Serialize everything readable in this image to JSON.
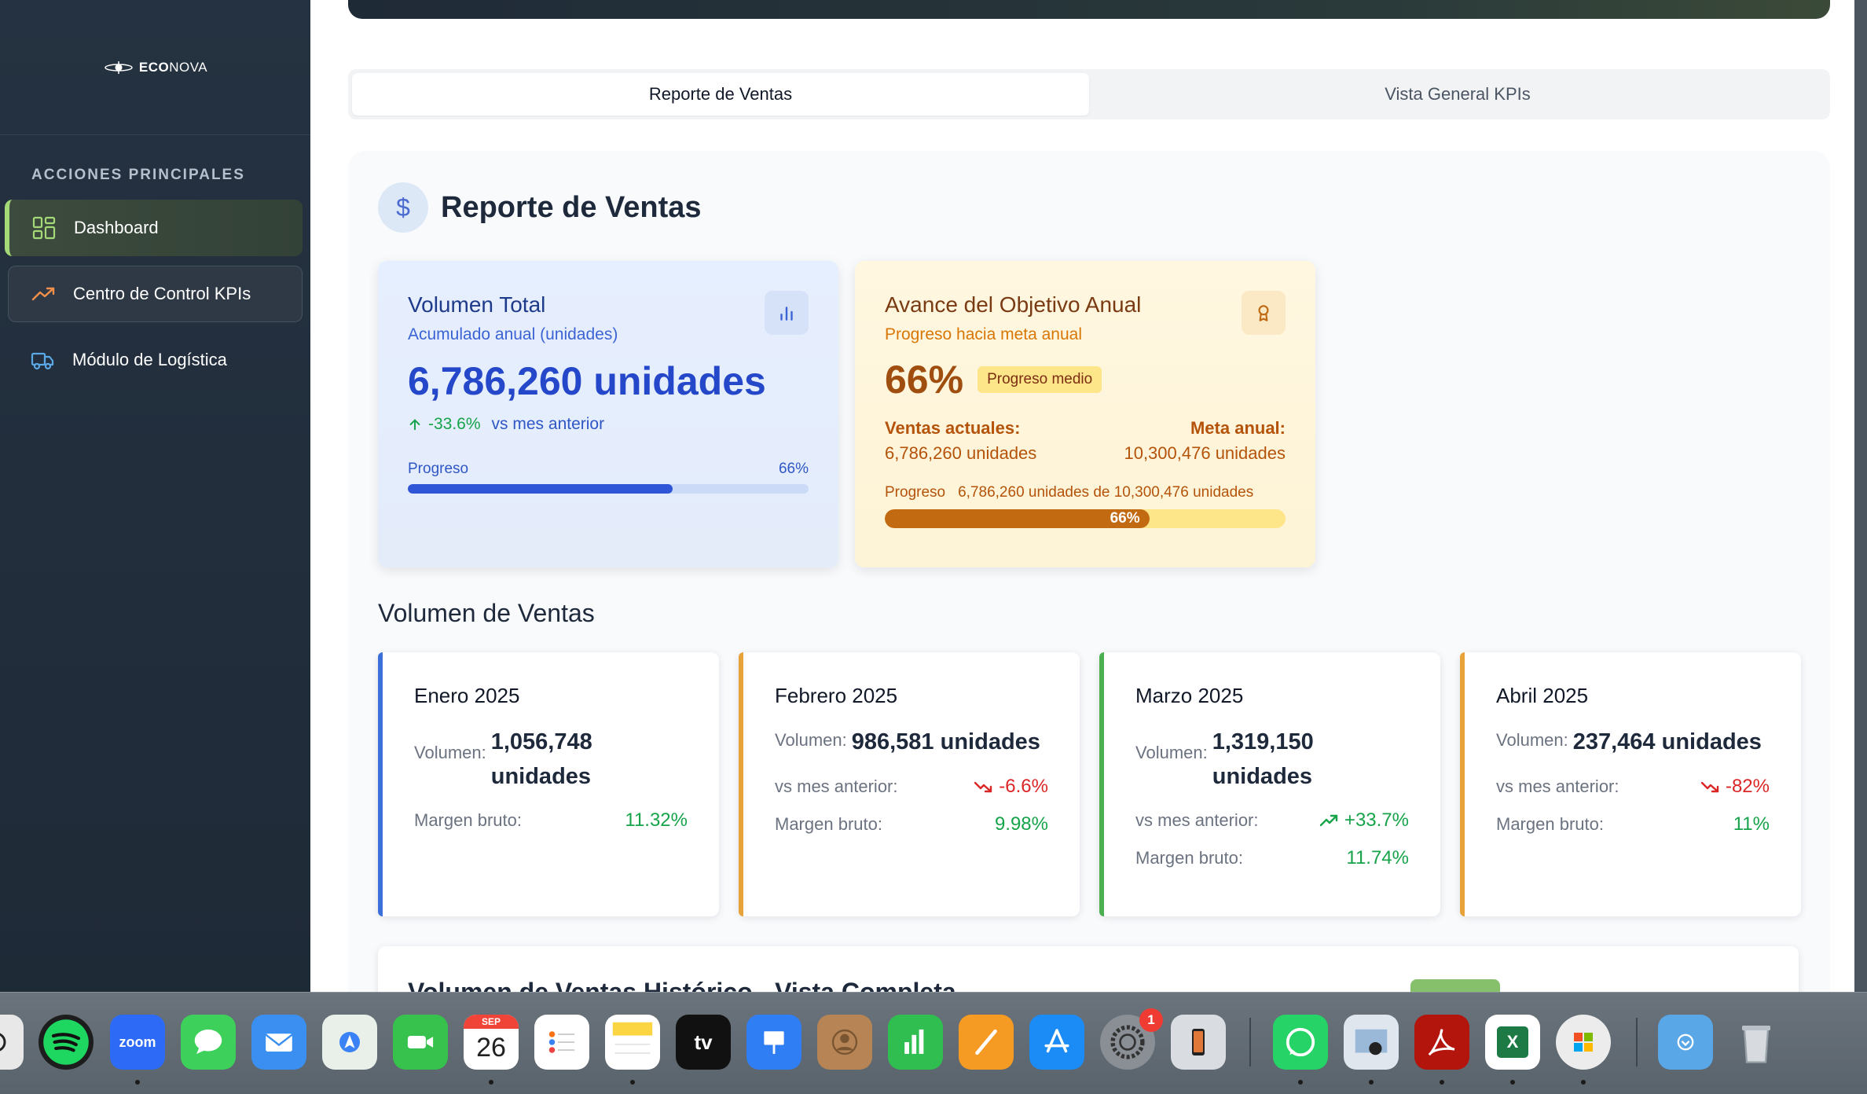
{
  "brand": {
    "name_bold": "ECO",
    "name_rest": "NOVA"
  },
  "sidebar": {
    "heading": "ACCIONES PRINCIPALES",
    "items": [
      {
        "label": "Dashboard",
        "icon": "dashboard-grid-icon",
        "state": "active"
      },
      {
        "label": "Centro de Control KPIs",
        "icon": "trending-up-icon",
        "state": "outlined"
      },
      {
        "label": "Módulo de Logística",
        "icon": "truck-icon",
        "state": "normal"
      }
    ]
  },
  "tabs": [
    {
      "label": "Reporte de Ventas",
      "active": true
    },
    {
      "label": "Vista General KPIs",
      "active": false
    }
  ],
  "section": {
    "title": "Reporte de Ventas",
    "icon": "dollar-icon"
  },
  "kpi_volume": {
    "title": "Volumen Total",
    "subtitle": "Acumulado anual (unidades)",
    "value": "6,786,260 unidades",
    "change": "-33.6%",
    "change_label": "vs mes anterior",
    "progress_label": "Progreso",
    "progress_text": "66%",
    "progress_value": 0.66,
    "icon": "bar-chart-icon"
  },
  "kpi_goal": {
    "title": "Avance del Objetivo Anual",
    "subtitle": "Progreso hacia meta anual",
    "value": "66%",
    "badge": "Progreso medio",
    "current_label": "Ventas actuales:",
    "current_value": "6,786,260 unidades",
    "target_label": "Meta anual:",
    "target_value": "10,300,476 unidades",
    "progress_label": "Progreso",
    "progress_detail": "6,786,260 unidades de 10,300,476 unidades",
    "progress_text": "66%",
    "progress_value": 0.66,
    "icon": "award-icon"
  },
  "subsection_title": "Volumen de Ventas",
  "months": [
    {
      "name": "Enero 2025",
      "volume_label": "Volumen:",
      "volume": "1,056,748 unidades",
      "change_label": "",
      "change": "",
      "trend": "",
      "margin_label": "Margen bruto:",
      "margin": "11.32%",
      "accent": "#3b6fd9"
    },
    {
      "name": "Febrero 2025",
      "volume_label": "Volumen:",
      "volume": "986,581 unidades",
      "change_label": "vs mes anterior:",
      "change": "-6.6%",
      "trend": "down",
      "margin_label": "Margen bruto:",
      "margin": "9.98%",
      "accent": "#e8a23a"
    },
    {
      "name": "Marzo 2025",
      "volume_label": "Volumen:",
      "volume": "1,319,150 unidades",
      "change_label": "vs mes anterior:",
      "change": "+33.7%",
      "trend": "up",
      "margin_label": "Margen bruto:",
      "margin": "11.74%",
      "accent": "#4caf50"
    },
    {
      "name": "Abril 2025",
      "volume_label": "Volumen:",
      "volume": "237,464 unidades",
      "change_label": "vs mes anterior:",
      "change": "-82%",
      "trend": "down",
      "margin_label": "Margen bruto:",
      "margin": "11%",
      "accent": "#e8a23a"
    }
  ],
  "bottom_card_title": "Volumen de Ventas Histórico - Vista Completa",
  "dock": {
    "calendar_month": "SEP",
    "calendar_day": "26",
    "zoom_label": "zoom",
    "settings_badge": "1",
    "apps": [
      "chatgpt-icon",
      "spotify-icon",
      "zoom-icon",
      "messages-icon",
      "mail-icon",
      "maps-icon",
      "facetime-icon",
      "calendar-icon",
      "reminders-icon",
      "notes-icon",
      "appletv-icon",
      "keynote-icon",
      "contacts-icon",
      "numbers-icon",
      "pages-icon",
      "appstore-icon",
      "settings-icon",
      "iphone-mirroring-icon",
      "whatsapp-icon",
      "preview-icon",
      "acrobat-icon",
      "excel-icon",
      "office-installer-icon",
      "downloads-folder-icon",
      "trash-icon"
    ]
  }
}
